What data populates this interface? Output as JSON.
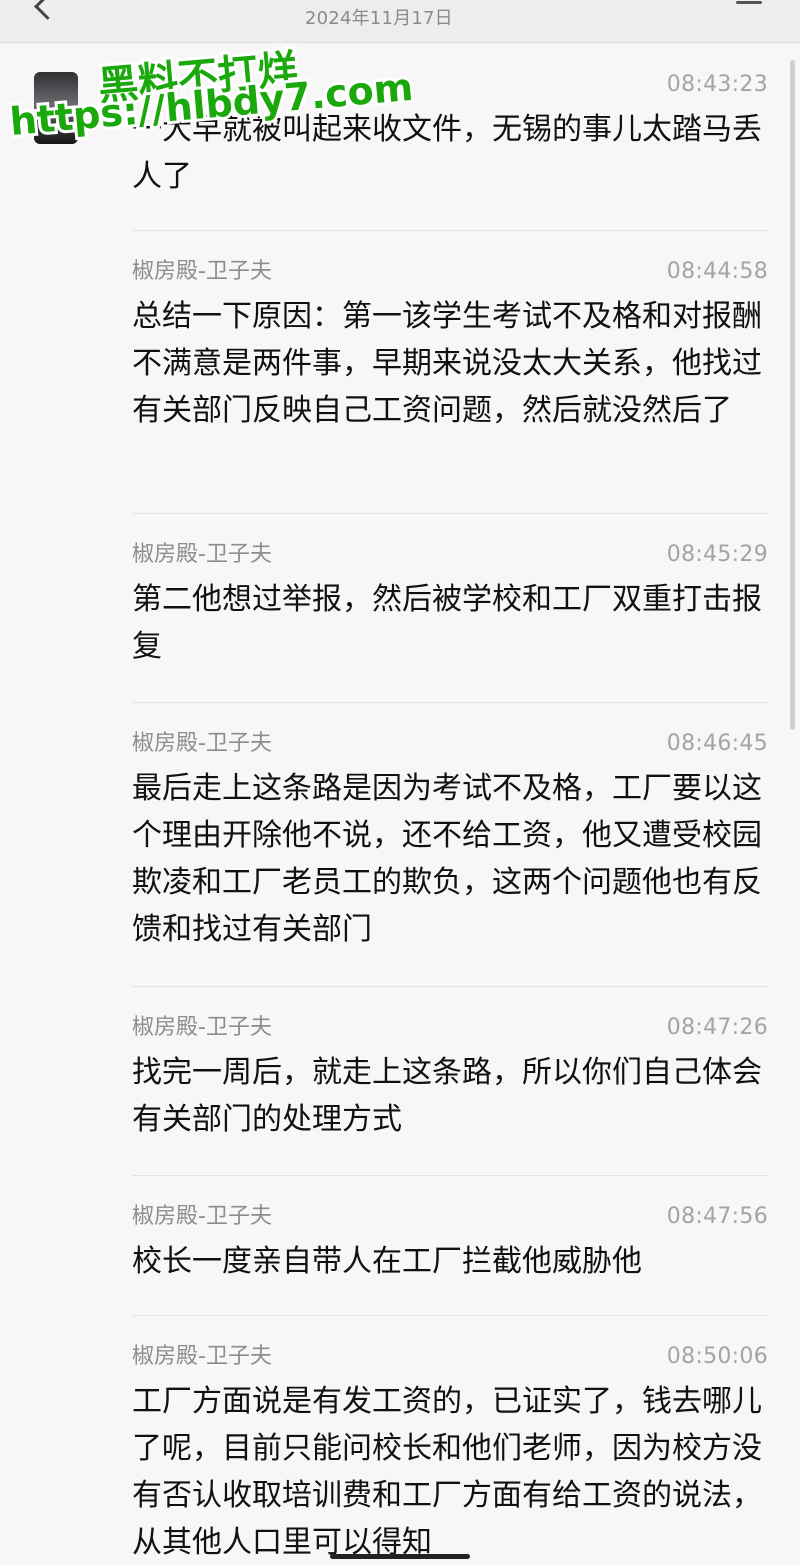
{
  "header": {
    "date": "2024年11月17日"
  },
  "watermark": {
    "line1": "黑料不打烊",
    "line2": "https://hlbdy7.com"
  },
  "messages": [
    {
      "sender": "",
      "time": "08:43:23",
      "text": "一大早就被叫起来收文件，无锡的事儿太踏马丢人了"
    },
    {
      "sender": "椒房殿-卫子夫",
      "time": "08:44:58",
      "text": "总结一下原因：第一该学生考试不及格和对报酬不满意是两件事，早期来说没太大关系，他找过有关部门反映自己工资问题，然后就没然后了"
    },
    {
      "sender": "椒房殿-卫子夫",
      "time": "08:45:29",
      "text": "第二他想过举报，然后被学校和工厂双重打击报复"
    },
    {
      "sender": "椒房殿-卫子夫",
      "time": "08:46:45",
      "text": "最后走上这条路是因为考试不及格，工厂要以这个理由开除他不说，还不给工资，他又遭受校园欺凌和工厂老员工的欺负，这两个问题他也有反馈和找过有关部门"
    },
    {
      "sender": "椒房殿-卫子夫",
      "time": "08:47:26",
      "text": "找完一周后，就走上这条路，所以你们自己体会有关部门的处理方式"
    },
    {
      "sender": "椒房殿-卫子夫",
      "time": "08:47:56",
      "text": "校长一度亲自带人在工厂拦截他威胁他"
    },
    {
      "sender": "椒房殿-卫子夫",
      "time": "08:50:06",
      "text": "工厂方面说是有发工资的，已证实了，钱去哪儿了呢，目前只能问校长和他们老师，因为校方没有否认收取培训费和工厂方面有给工资的说法，从其他人口里可以得知"
    }
  ]
}
